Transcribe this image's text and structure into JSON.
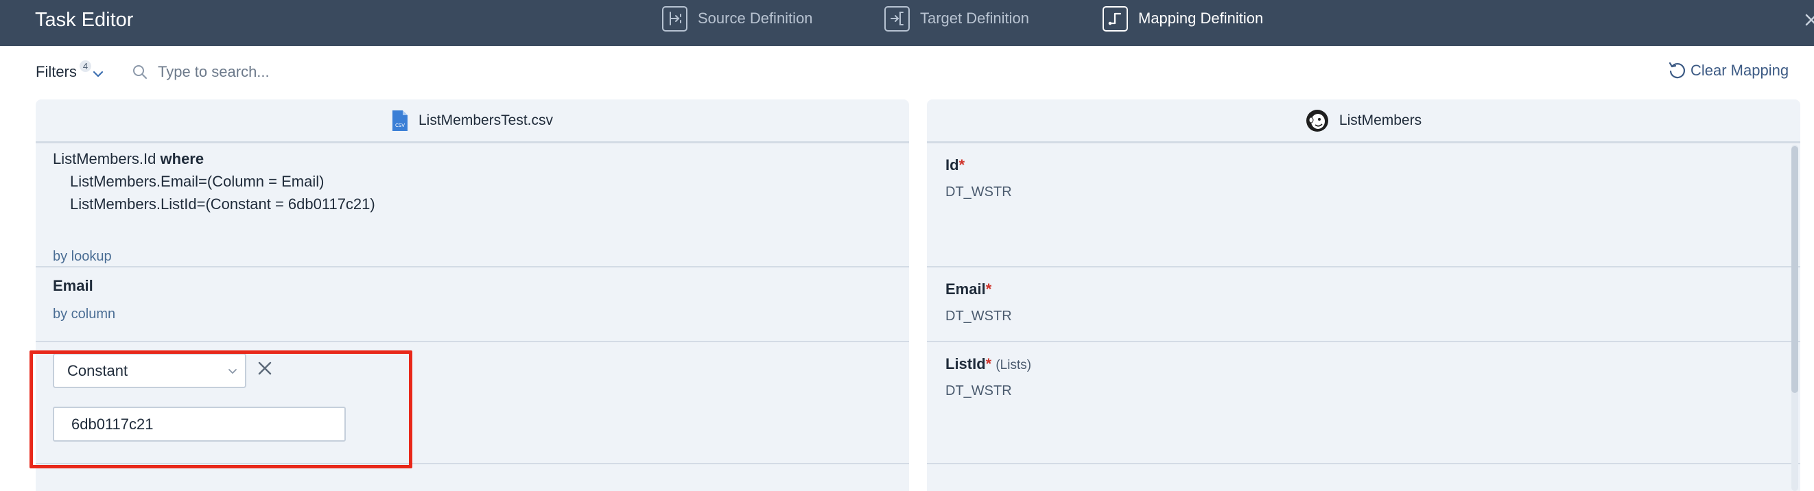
{
  "header": {
    "title": "Task Editor",
    "tabs": [
      {
        "label": "Source Definition",
        "icon": "source-definition-icon",
        "active": false
      },
      {
        "label": "Target Definition",
        "icon": "target-definition-icon",
        "active": false
      },
      {
        "label": "Mapping Definition",
        "icon": "mapping-definition-icon",
        "active": true
      }
    ]
  },
  "toolbar": {
    "filters_label": "Filters",
    "filters_count": "4",
    "search_placeholder": "Type to search...",
    "search_value": "",
    "clear_label": "Clear Mapping"
  },
  "source_panel": {
    "title": "ListMembersTest.csv",
    "file_icon_text": "CSV",
    "rows": {
      "lookup": {
        "field": "ListMembers.Id",
        "keyword": "where",
        "cond1": "ListMembers.Email=(Column = Email)",
        "cond2": "ListMembers.ListId=(Constant = 6db0117c21)",
        "mode": "by lookup"
      },
      "email": {
        "field": "Email",
        "mode": "by column"
      },
      "listid": {
        "mode_selected": "Constant",
        "constant_value": "6db0117c21"
      }
    }
  },
  "target_panel": {
    "title": "ListMembers",
    "fields": [
      {
        "name": "Id",
        "required": "*",
        "note": "",
        "type": "DT_WSTR"
      },
      {
        "name": "Email",
        "required": "*",
        "note": "",
        "type": "DT_WSTR"
      },
      {
        "name": "ListId",
        "required": "*",
        "note": "(Lists)",
        "type": "DT_WSTR"
      }
    ]
  },
  "colors": {
    "header_bg": "#3a4a5e",
    "panel_bg": "#eff3f8",
    "required": "#d0342c",
    "highlight": "#e8281a",
    "link": "#3c5a84"
  }
}
